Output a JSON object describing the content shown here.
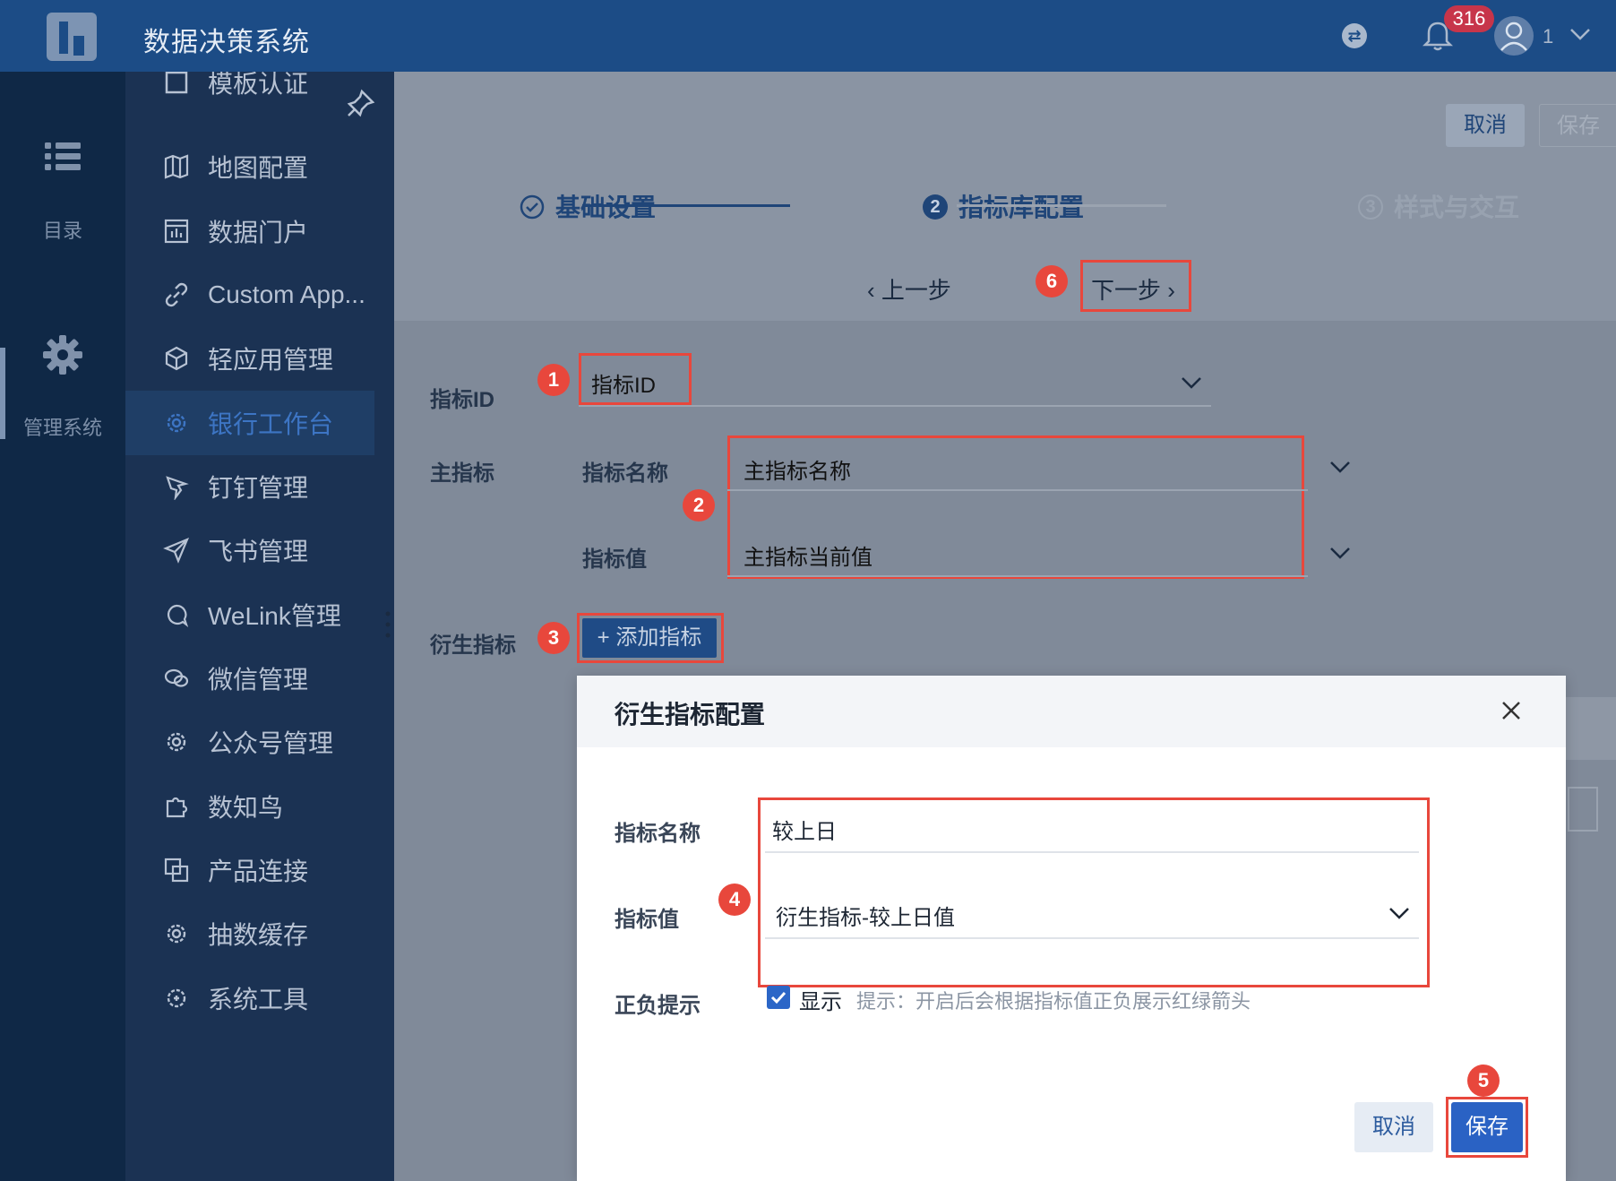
{
  "header": {
    "app_title": "数据决策系统",
    "notification_count": "316",
    "user_name": "1"
  },
  "rail": {
    "catalog_label": "目录",
    "admin_label": "管理系统"
  },
  "sidebar": {
    "items": [
      {
        "label": "模板认证",
        "icon": "template-icon"
      },
      {
        "label": "地图配置",
        "icon": "map-icon"
      },
      {
        "label": "数据门户",
        "icon": "portal-icon"
      },
      {
        "label": "Custom App...",
        "icon": "link-icon"
      },
      {
        "label": "轻应用管理",
        "icon": "cube-icon"
      },
      {
        "label": "银行工作台",
        "icon": "gear-icon",
        "active": true
      },
      {
        "label": "钉钉管理",
        "icon": "dingtalk-icon"
      },
      {
        "label": "飞书管理",
        "icon": "paper-plane-icon"
      },
      {
        "label": "WeLink管理",
        "icon": "welink-icon"
      },
      {
        "label": "微信管理",
        "icon": "wechat-icon"
      },
      {
        "label": "公众号管理",
        "icon": "gear-icon"
      },
      {
        "label": "数知鸟",
        "icon": "puzzle-icon"
      },
      {
        "label": "产品连接",
        "icon": "connect-icon"
      },
      {
        "label": "抽数缓存",
        "icon": "gear-icon"
      },
      {
        "label": "系统工具",
        "icon": "tools-icon"
      }
    ]
  },
  "toolbar": {
    "cancel_label": "取消",
    "save_label": "保存"
  },
  "steps": [
    {
      "label": "基础设置",
      "state": "done"
    },
    {
      "number": "2",
      "label": "指标库配置",
      "state": "current"
    },
    {
      "number": "3",
      "label": "样式与交互",
      "state": "pending"
    }
  ],
  "nav": {
    "prev_label": "上一步",
    "next_label": "下一步"
  },
  "form": {
    "metric_id": {
      "label": "指标ID",
      "value": "指标ID"
    },
    "main_metric": {
      "label": "主指标",
      "name_label": "指标名称",
      "name_value": "主指标名称",
      "value_label": "指标值",
      "value_value": "主指标当前值"
    },
    "derived": {
      "label": "衍生指标",
      "add_button": "+ 添加指标"
    }
  },
  "modal": {
    "title": "衍生指标配置",
    "name_label": "指标名称",
    "name_value": "较上日",
    "value_label": "指标值",
    "value_value": "衍生指标-较上日值",
    "sign_label": "正负提示",
    "show_label": "显示",
    "show_checked": true,
    "hint": "提示：开启后会根据指标值正负展示红绿箭头",
    "cancel_label": "取消",
    "save_label": "保存"
  },
  "callouts": [
    "1",
    "2",
    "3",
    "4",
    "5",
    "6"
  ],
  "colors": {
    "topbar": "#1c4c86",
    "accent": "#2a62c4",
    "callout": "#e8473c",
    "overlay_bg": "#808a99"
  }
}
